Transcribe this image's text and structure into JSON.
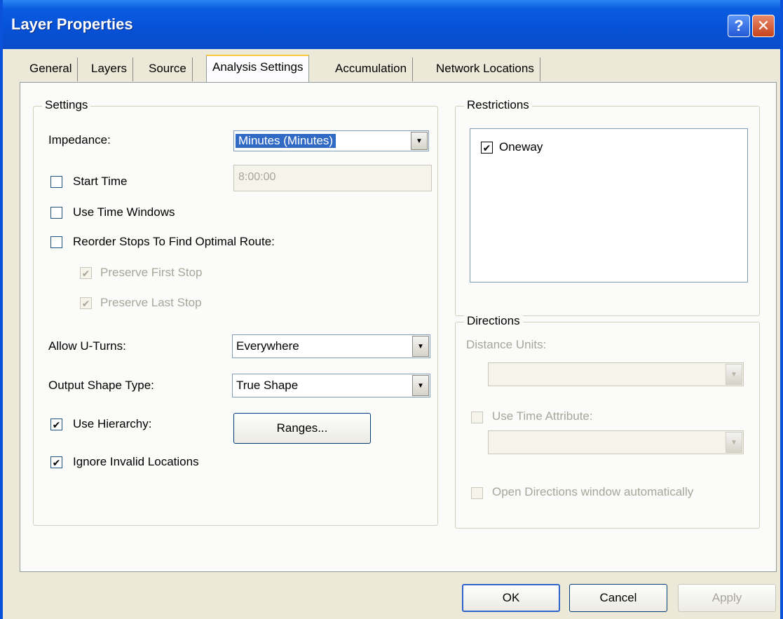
{
  "window": {
    "title": "Layer Properties",
    "help_glyph": "?",
    "close_glyph": "✕"
  },
  "tabs": [
    {
      "label": "General"
    },
    {
      "label": "Layers"
    },
    {
      "label": "Source"
    },
    {
      "label": "Analysis Settings"
    },
    {
      "label": "Accumulation"
    },
    {
      "label": "Network Locations"
    }
  ],
  "settings": {
    "group_label": "Settings",
    "impedance_label": "Impedance:",
    "impedance_value": "Minutes (Minutes)",
    "start_time_label": "Start Time",
    "start_time_value": "8:00:00",
    "use_time_windows_label": "Use Time Windows",
    "reorder_stops_label": "Reorder Stops To Find Optimal Route:",
    "preserve_first_label": "Preserve First Stop",
    "preserve_last_label": "Preserve Last Stop",
    "allow_uturns_label": "Allow U-Turns:",
    "allow_uturns_value": "Everywhere",
    "output_shape_label": "Output Shape Type:",
    "output_shape_value": "True Shape",
    "use_hierarchy_label": "Use Hierarchy:",
    "ranges_button": "Ranges...",
    "ignore_invalid_label": "Ignore Invalid Locations"
  },
  "restrictions": {
    "group_label": "Restrictions",
    "items": [
      {
        "label": "Oneway",
        "checked": true
      }
    ]
  },
  "directions": {
    "group_label": "Directions",
    "distance_units_label": "Distance Units:",
    "use_time_attribute_label": "Use Time Attribute:",
    "open_window_label": "Open Directions window automatically"
  },
  "buttons": {
    "ok": "OK",
    "cancel": "Cancel",
    "apply": "Apply"
  },
  "check_glyph": "✔",
  "arrow_glyph": "▼",
  "colors": {
    "titlebar": "#0651d6",
    "selection": "#316ac5",
    "tab_highlight": "#ffc83c"
  }
}
